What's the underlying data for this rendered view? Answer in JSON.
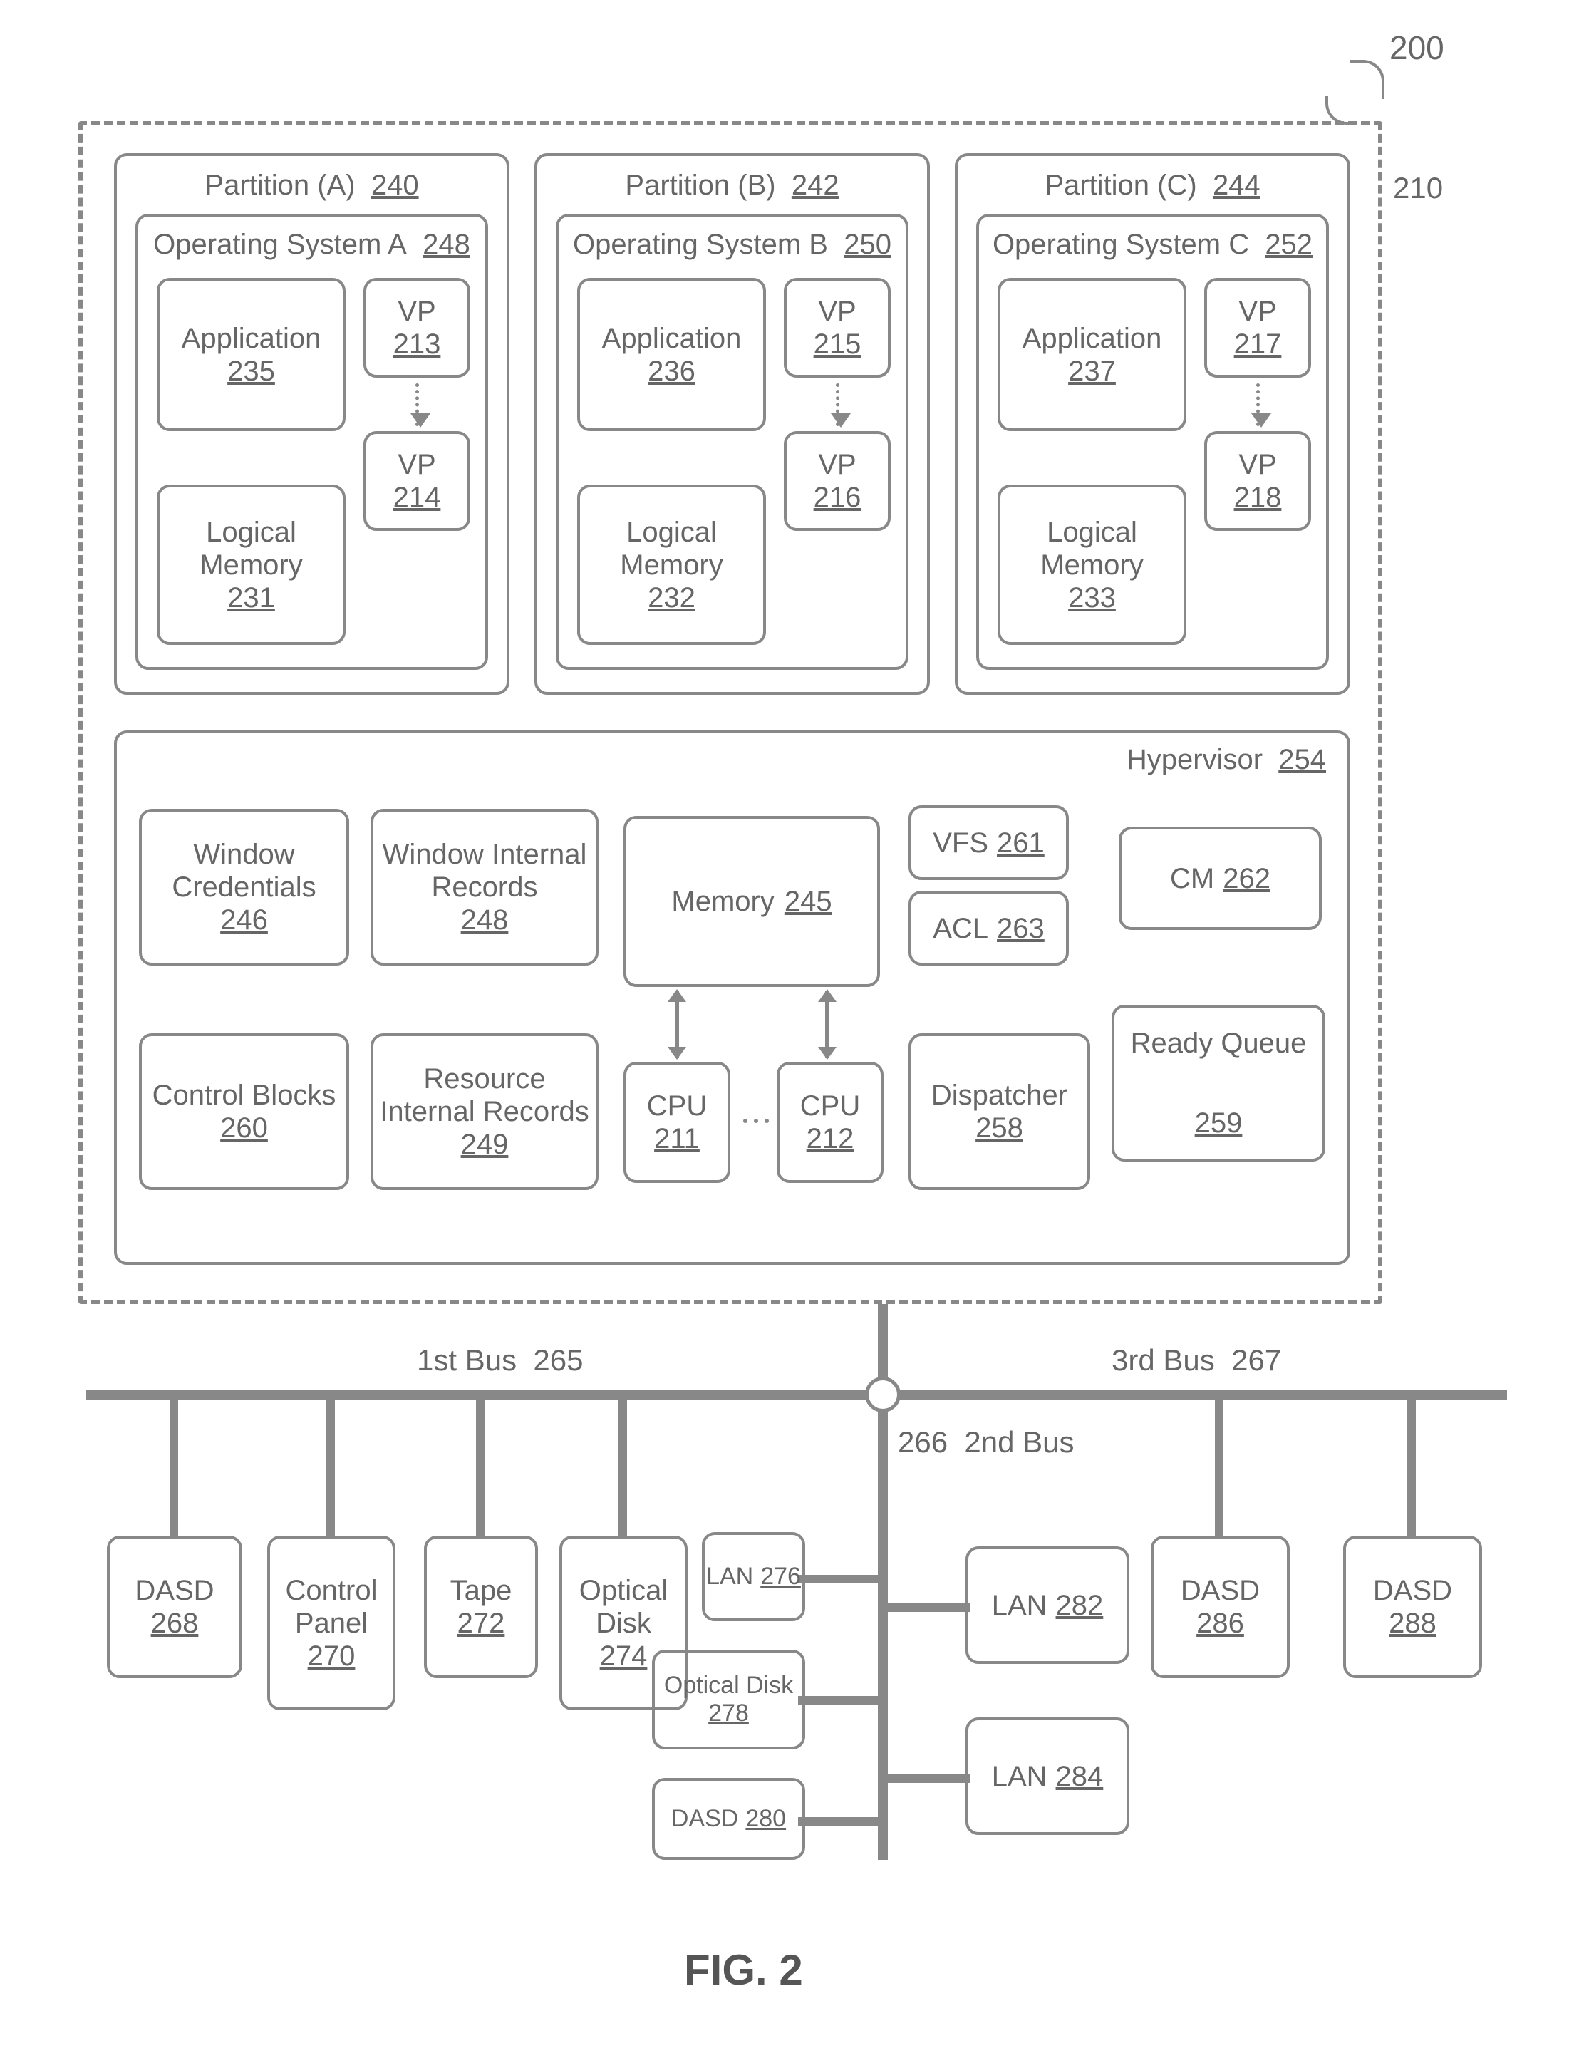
{
  "figure": {
    "label": "FIG. 2",
    "ref_200": "200",
    "ref_210": "210"
  },
  "partitions": {
    "A": {
      "title": "Partition (A)",
      "ref": "240",
      "os": {
        "title": "Operating System A",
        "ref": "248"
      },
      "app": {
        "title": "Application",
        "ref": "235"
      },
      "vp1": {
        "title": "VP",
        "ref": "213"
      },
      "vp2": {
        "title": "VP",
        "ref": "214"
      },
      "lm": {
        "title": "Logical Memory",
        "ref": "231"
      }
    },
    "B": {
      "title": "Partition (B)",
      "ref": "242",
      "os": {
        "title": "Operating System B",
        "ref": "250"
      },
      "app": {
        "title": "Application",
        "ref": "236"
      },
      "vp1": {
        "title": "VP",
        "ref": "215"
      },
      "vp2": {
        "title": "VP",
        "ref": "216"
      },
      "lm": {
        "title": "Logical Memory",
        "ref": "232"
      }
    },
    "C": {
      "title": "Partition (C)",
      "ref": "244",
      "os": {
        "title": "Operating System C",
        "ref": "252"
      },
      "app": {
        "title": "Application",
        "ref": "237"
      },
      "vp1": {
        "title": "VP",
        "ref": "217"
      },
      "vp2": {
        "title": "VP",
        "ref": "218"
      },
      "lm": {
        "title": "Logical Memory",
        "ref": "233"
      }
    }
  },
  "hypervisor": {
    "title": "Hypervisor",
    "ref": "254",
    "wc": {
      "title": "Window Credentials",
      "ref": "246"
    },
    "cb": {
      "title": "Control Blocks",
      "ref": "260"
    },
    "wir": {
      "title": "Window Internal Records",
      "ref": "248"
    },
    "rir": {
      "title": "Resource Internal Records",
      "ref": "249"
    },
    "mem": {
      "title": "Memory",
      "ref": "245"
    },
    "cpu1": {
      "title": "CPU",
      "ref": "211"
    },
    "cpu2": {
      "title": "CPU",
      "ref": "212"
    },
    "vfs": {
      "title": "VFS",
      "ref": "261"
    },
    "acl": {
      "title": "ACL",
      "ref": "263"
    },
    "disp": {
      "title": "Dispatcher",
      "ref": "258"
    },
    "cm": {
      "title": "CM",
      "ref": "262"
    },
    "rq": {
      "title": "Ready Queue",
      "ref": "259"
    }
  },
  "buses": {
    "first": {
      "title": "1st Bus",
      "ref": "265"
    },
    "second": {
      "title": "2nd Bus",
      "ref": "266"
    },
    "third": {
      "title": "3rd Bus",
      "ref": "267"
    }
  },
  "devices": {
    "dasd268": {
      "title": "DASD",
      "ref": "268"
    },
    "cp270": {
      "title": "Control Panel",
      "ref": "270"
    },
    "tape272": {
      "title": "Tape",
      "ref": "272"
    },
    "od274": {
      "title": "Optical Disk",
      "ref": "274"
    },
    "lan276": {
      "title": "LAN",
      "ref": "276"
    },
    "od278": {
      "title": "Optical Disk",
      "ref": "278"
    },
    "dasd280": {
      "title": "DASD",
      "ref": "280"
    },
    "lan282": {
      "title": "LAN",
      "ref": "282"
    },
    "lan284": {
      "title": "LAN",
      "ref": "284"
    },
    "dasd286": {
      "title": "DASD",
      "ref": "286"
    },
    "dasd288": {
      "title": "DASD",
      "ref": "288"
    }
  }
}
